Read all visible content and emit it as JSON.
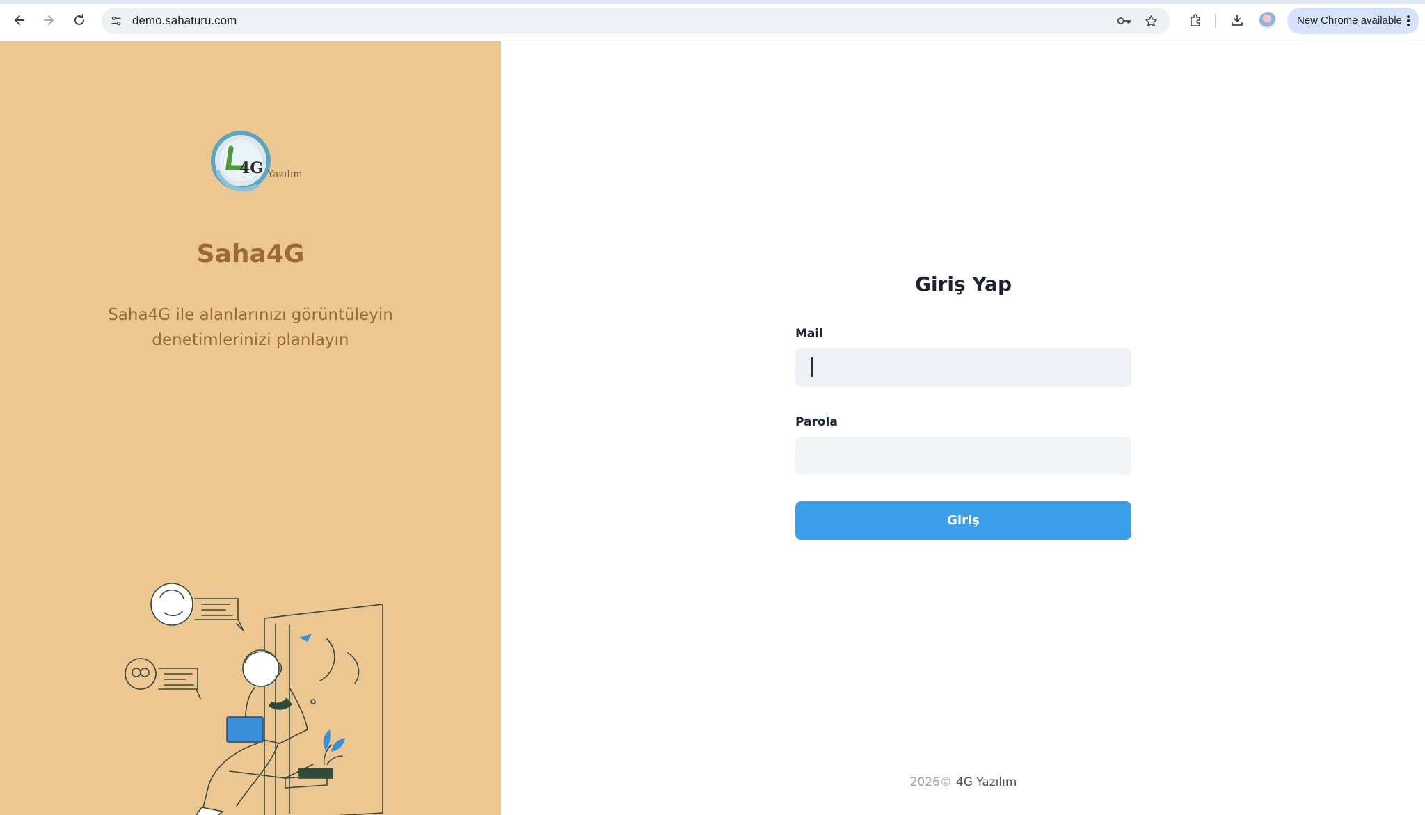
{
  "browser": {
    "url": "demo.sahaturu.com",
    "update_label": "New Chrome available"
  },
  "brand": {
    "logo_text": "4G",
    "logo_wordmark": "Yazılım",
    "name": "Saha4G",
    "tagline": "Saha4G ile alanlarınızı görüntüleyin denetimlerinizi planlayın"
  },
  "login": {
    "title": "Giriş Yap",
    "mail_label": "Mail",
    "mail_value": "",
    "password_label": "Parola",
    "password_value": "",
    "submit_label": "Giriş"
  },
  "footer": {
    "year": "2026©",
    "company": "4G Yazılım"
  },
  "colors": {
    "left_panel": "#ecc792",
    "brand_text": "#9a6a32",
    "button": "#3b9fec"
  }
}
